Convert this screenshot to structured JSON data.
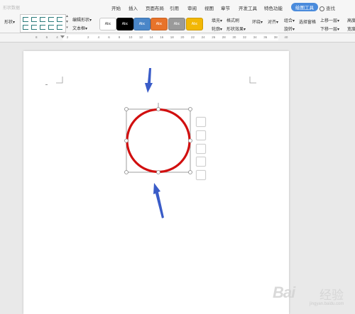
{
  "tabbar": {
    "left_dim_text": "形状数据",
    "tabs": [
      "开始",
      "插入",
      "页面布局",
      "引用",
      "审阅",
      "视图",
      "章节",
      "开发工具",
      "特色功能",
      "绘图工具",
      "查找"
    ]
  },
  "ribbon": {
    "shape_label": "形状",
    "edit_shape": "编辑形状",
    "text_box": "文本框",
    "style_label": "Abc",
    "fill": "填充",
    "outline": "轮廓",
    "format_brush": "格式刷",
    "shape_effects": "形状效果",
    "wrap": "环绕",
    "align": "对齐",
    "group": "组合",
    "rotate": "旋转",
    "selection_pane": "选择窗格",
    "bring_forward": "上移一层",
    "send_backward": "下移一层",
    "height": "高度",
    "width": "宽度",
    "swatch_colors": [
      "#ffffff",
      "#000000",
      "#4a86c8",
      "#e8732a",
      "#9a9a9a",
      "#f2b705"
    ],
    "swatch_text_colors": [
      "#333333",
      "#ffffff",
      "#ffffff",
      "#ffffff",
      "#ffffff",
      "#ffffff"
    ]
  },
  "ruler": {
    "labels": [
      "8",
      "6",
      "4",
      "2",
      "",
      "2",
      "4",
      "6",
      "8",
      "10",
      "12",
      "14",
      "16",
      "18",
      "20",
      "22",
      "24",
      "26",
      "28",
      "30",
      "32",
      "34",
      "36",
      "38",
      "40"
    ]
  },
  "shape": {
    "type": "circle",
    "stroke_color": "#d10f0f",
    "selection_handle_color": "#888888",
    "arrow_color": "#3a5cc8"
  },
  "watermark": {
    "logo": "Bai",
    "logo2": "经验",
    "sub": "jingyan.baidu.com"
  }
}
